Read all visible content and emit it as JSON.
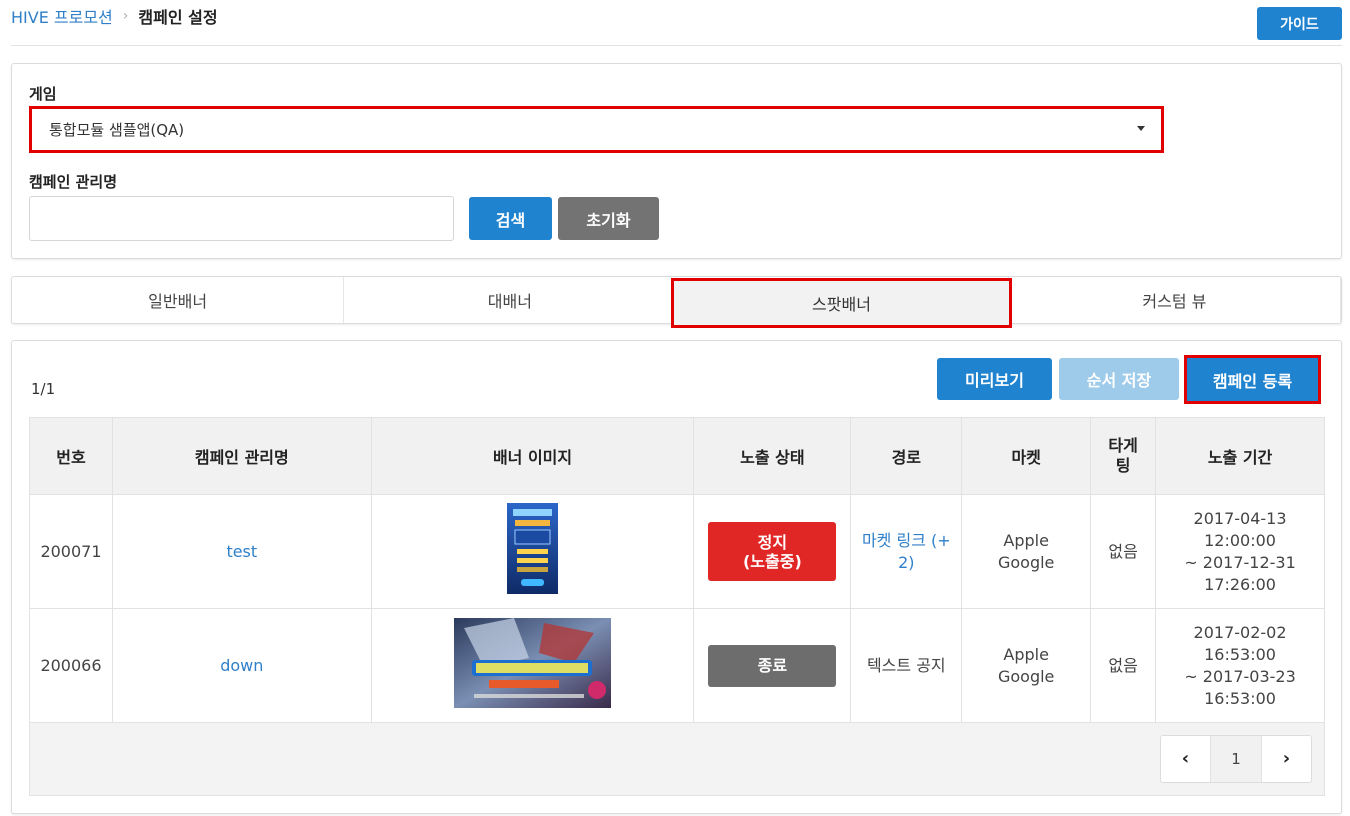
{
  "breadcrumb": {
    "root": "HIVE 프로모션",
    "separator": "›",
    "current": "캠페인 설정"
  },
  "header": {
    "guide_label": "가이드"
  },
  "search": {
    "game_label": "게임",
    "game_selected": "통합모듈 샘플앱(QA)",
    "name_label": "캠페인 관리명",
    "name_value": "",
    "search_label": "검색",
    "reset_label": "초기화"
  },
  "tabs": [
    "일반배너",
    "대배너",
    "스팟배너",
    "커스텀 뷰"
  ],
  "active_tab": "스팟배너",
  "list": {
    "count": "1/1",
    "preview_label": "미리보기",
    "save_order_label": "순서 저장",
    "register_label": "캠페인 등록",
    "columns": [
      "번호",
      "캠페인 관리명",
      "배너 이미지",
      "노출 상태",
      "경로",
      "마켓",
      "타게\n팅",
      "노출 기간"
    ],
    "rows": [
      {
        "id": "200071",
        "name": "test",
        "banner": "tall-banner-thumbnail",
        "status_line1": "정지",
        "status_line2": "(노출중)",
        "status_color": "#e12626",
        "route_line1": "마켓 링크 (+",
        "route_line2": "2)",
        "route_is_link": true,
        "market_line1": "Apple",
        "market_line2": "Google",
        "targeting": "없음",
        "period_start_date": "2017-04-13",
        "period_start_time": "12:00:00",
        "period_end_date": "~ 2017-12-31",
        "period_end_time": "17:26:00"
      },
      {
        "id": "200066",
        "name": "down",
        "banner": "wide-banner-thumbnail",
        "status_line1": "종료",
        "status_color": "#6d6d6d",
        "route_line1": "텍스트 공지",
        "route_is_link": false,
        "market_line1": "Apple",
        "market_line2": "Google",
        "targeting": "없음",
        "period_start_date": "2017-02-02",
        "period_start_time": "16:53:00",
        "period_end_date": "~ 2017-03-23",
        "period_end_time": "16:53:00"
      }
    ],
    "pager": {
      "prev_icon": "chevron-left-icon",
      "page": "1",
      "next_icon": "chevron-right-icon"
    }
  },
  "colors": {
    "primary": "#1f83cf",
    "primary_disabled": "#9fcbea",
    "danger": "#e12626",
    "neutral": "#737373",
    "highlight_outline": "#e00000"
  }
}
